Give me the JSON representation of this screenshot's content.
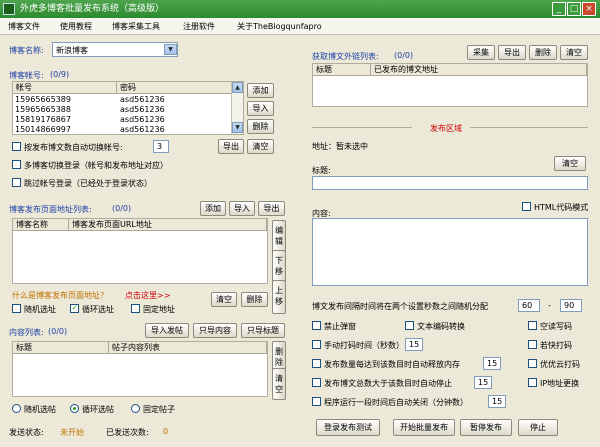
{
  "window": {
    "title": "外虎多博客批量发布系统（高级版）"
  },
  "menu": [
    "博客文件",
    "使用教程",
    "博客采集工具",
    "注册软件",
    "关于TheBlogqunfapro"
  ],
  "left": {
    "blog_name_label": "博客名称:",
    "blog_name_value": "新浪博客",
    "accounts_label": "博客帐号:",
    "accounts_count": "(0/9)",
    "accounts_col_user": "帐号",
    "accounts_col_pass": "密码",
    "accounts": [
      {
        "user": "15965665389",
        "pass": "asd561236"
      },
      {
        "user": "15965665388",
        "pass": "asd561236"
      },
      {
        "user": "15819176867",
        "pass": "asd561236"
      },
      {
        "user": "15014866997",
        "pass": "asd561236"
      }
    ],
    "btn_add": "添加",
    "btn_import": "导入",
    "btn_delete": "删除",
    "btn_export": "导出",
    "btn_clear": "清空",
    "auto_switch_label": "按发布博文数自动切换帐号:",
    "auto_switch_value": "3",
    "multi_login_label": "多博客切换登录（帐号和发布地址对应）",
    "skip_login_label": "跳过帐号登录（已经处于登录状态）",
    "pub_urls_label": "博客发布页面地址列表:",
    "pub_urls_count": "(0/0)",
    "pub_urls_col_name": "博客名称",
    "pub_urls_col_url": "博客发布页面URL地址",
    "btn_edit": "编辑",
    "btn_down": "下移",
    "btn_up": "上移",
    "what_is_url": "什么是博客发布页面地址？",
    "click_here": "点击这里>>",
    "url_random": "随机选址",
    "url_loop": "循环选址",
    "url_fixed": "固定地址",
    "content_list_label": "内容列表:",
    "content_list_count": "(0/0)",
    "btn_import_post": "导入发帖",
    "btn_import_content": "只导内容",
    "btn_import_title": "只导标题",
    "content_col_title": "标题",
    "content_col_body": "帖子内容列表",
    "post_random": "随机选帖",
    "post_loop": "循环选帖",
    "post_fixed": "固定帖子",
    "status_label": "发送状态:",
    "status_value": "未开始",
    "sent_label": "已发送次数:",
    "sent_value": "0"
  },
  "right": {
    "links_label": "获取博文外链列表:",
    "links_count": "(0/0)",
    "btn_collect": "采集",
    "btn_export": "导出",
    "btn_delete": "删除",
    "btn_clear": "清空",
    "links_col_title": "标题",
    "links_col_url": "已发布的博文地址",
    "publish_area": "发布区域",
    "address_label": "地址：暂未选中",
    "title_label": "标题:",
    "btn_clear_title": "清空",
    "content_label": "内容:",
    "html_mode": "HTML代码模式",
    "interval_label": "博文发布间隔时间将在两个设置秒数之间随机分配",
    "interval_min": "60",
    "interval_sep": "-",
    "interval_max": "90",
    "opt_no_popup": "禁止弹窗",
    "opt_text_encode": "文本编码转换",
    "opt_blank_write": "空读写码",
    "opt_manual_captcha": "手动打码时间（秒数）",
    "manual_captcha_value": "15",
    "opt_if_captcha": "若快打码",
    "opt_pause_after": "发布数量每达到该数目时自动释放内存",
    "pause_after_value": "15",
    "opt_cloud_captcha": "优优云打码",
    "opt_stop_after": "发布博文总数大于该数目时自动停止",
    "stop_after_value": "15",
    "opt_ip_change": "IP地址更换",
    "opt_auto_close": "程序运行一段时间后自动关闭（分钟数）",
    "auto_close_value": "15",
    "btn_test": "登录发布测试",
    "btn_start": "开始批量发布",
    "btn_stop": "暂停发布",
    "btn_close": "停止"
  }
}
